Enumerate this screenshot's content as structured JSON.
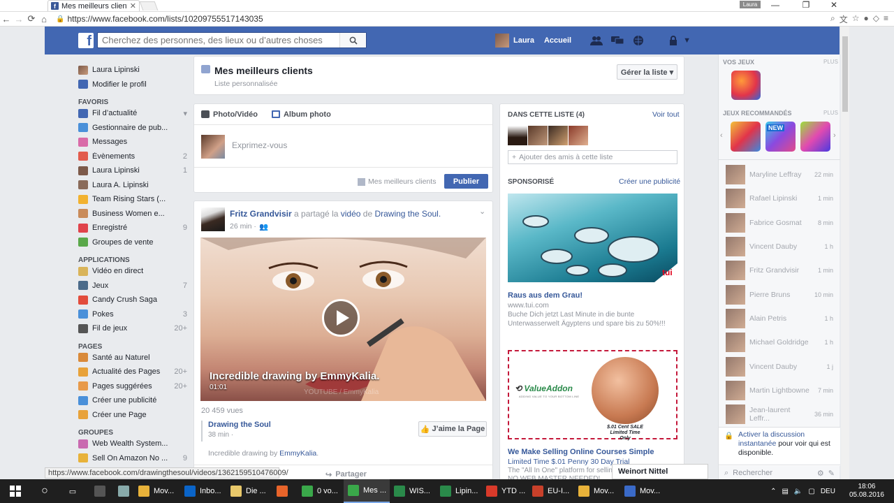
{
  "browser": {
    "tab_title": "Mes meilleurs clients",
    "profile_chip": "Laura",
    "url": "https://www.facebook.com/lists/10209755517143035",
    "status_url": "https://www.facebook.com/drawingthesoul/videos/1362159510476009/"
  },
  "header": {
    "search_placeholder": "Cherchez des personnes, des lieux ou d’autres choses",
    "user_name": "Laura",
    "home": "Accueil"
  },
  "left_nav": {
    "profile": [
      {
        "label": "Laura Lipinski"
      },
      {
        "label": "Modifier le profil"
      }
    ],
    "favoris_title": "FAVORIS",
    "favoris": [
      {
        "label": "Fil d’actualité",
        "count": "▾",
        "color": "#4267b2"
      },
      {
        "label": "Gestionnaire de pub...",
        "count": "",
        "color": "#4a90d9"
      },
      {
        "label": "Messages",
        "count": "",
        "color": "#d96ba8"
      },
      {
        "label": "Évènements",
        "count": "2",
        "color": "#e25b4c"
      },
      {
        "label": "Laura Lipinski",
        "count": "1",
        "color": "#7d5a4a"
      },
      {
        "label": "Laura A. Lipinski",
        "count": "",
        "color": "#8a6b5a"
      },
      {
        "label": "Team Rising Stars (...",
        "count": "",
        "color": "#f2b230"
      },
      {
        "label": "Business Women e...",
        "count": "",
        "color": "#c98b5a"
      },
      {
        "label": "Enregistré",
        "count": "9",
        "color": "#e0434b"
      },
      {
        "label": "Groupes de vente",
        "count": "",
        "color": "#5aa84a"
      }
    ],
    "applications_title": "APPLICATIONS",
    "applications": [
      {
        "label": "Vidéo en direct",
        "count": "",
        "color": "#d9b45a"
      },
      {
        "label": "Jeux",
        "count": "7",
        "color": "#4b6b8a"
      },
      {
        "label": "Candy Crush Saga",
        "count": "",
        "color": "#e24c3c"
      },
      {
        "label": "Pokes",
        "count": "3",
        "color": "#4a90d9"
      },
      {
        "label": "Fil de jeux",
        "count": "20+",
        "color": "#555"
      }
    ],
    "pages_title": "PAGES",
    "pages": [
      {
        "label": "Santé au Naturel",
        "count": "",
        "color": "#d98a3a"
      },
      {
        "label": "Actualité des Pages",
        "count": "20+",
        "color": "#e8a23a"
      },
      {
        "label": "Pages suggérées",
        "count": "20+",
        "color": "#e89a4a"
      },
      {
        "label": "Créer une publicité",
        "count": "",
        "color": "#4a90d9"
      },
      {
        "label": "Créer une Page",
        "count": "",
        "color": "#e8a23a"
      }
    ],
    "groupes_title": "GROUPES",
    "groupes": [
      {
        "label": "Web Wealth System...",
        "count": "",
        "color": "#c96ab0"
      },
      {
        "label": "Sell On Amazon No ...",
        "count": "9",
        "color": "#e8b23a"
      }
    ]
  },
  "list_header": {
    "title": "Mes meilleurs clients",
    "subtitle": "Liste personnalisée",
    "manage_button": "Gérer la liste ▾"
  },
  "composer": {
    "tab_photo": "Photo/Vidéo",
    "tab_album": "Album photo",
    "placeholder": "Exprimez-vous",
    "audience": "Mes meilleurs clients",
    "publish": "Publier"
  },
  "post": {
    "author": "Fritz Grandvisir",
    "shared": " a partagé la ",
    "video_word": "vidéo",
    "of": " de ",
    "page": "Drawing the Soul.",
    "time": "26 min ·",
    "video_title": "Incredible drawing by EmmyKalia.",
    "video_duration": "01:01",
    "video_watermark": "YOUTUBE / EmmyKalia",
    "views": "20 459 vues",
    "source_name": "Drawing the Soul",
    "source_time": "38 min ·",
    "like_page": "J’aime la Page",
    "desc_prefix": "Incredible drawing by ",
    "desc_link": "EmmyKalia",
    "desc_suffix": ".",
    "share": "Partager"
  },
  "list_panel": {
    "members_title": "DANS CETTE LISTE (4)",
    "see_all": "Voir tout",
    "add_placeholder": "Ajouter des amis à cette liste"
  },
  "sponsored": {
    "title": "SPONSORISÉ",
    "create_ad": "Créer une publicité",
    "ad1": {
      "headline": "Raus aus dem Grau!",
      "domain": "www.tui.com",
      "text": "Buche Dich jetzt Last Minute in die bunte Unterwasserwelt Ägyptens und spare bis zu 50%!!!",
      "brand": "tui"
    },
    "ad2": {
      "logo": "ValueAddon",
      "logo_tag": "ADDING VALUE TO YOUR BOTTOM LINE",
      "coin_caption1": "$.01 Cent SALE",
      "coin_caption2": "Limited Time Only",
      "headline": "We Make Selling Online Courses Simple",
      "line1": "Limited Time $.01 Penny 30 Day Trial",
      "line2": "The \"All In One\" platform for selling",
      "line3": "NO WEB MASTER NEEDED!"
    }
  },
  "right_sidebar": {
    "your_games": "VOS JEUX",
    "more": "PLUS",
    "recommended": "JEUX RECOMMANDÉS",
    "more2": "PLUS",
    "game2_badge": "NEW",
    "friends": [
      {
        "name": "Maryline Leffray",
        "time": "22 min"
      },
      {
        "name": "Rafael Lipinski",
        "time": "1 min"
      },
      {
        "name": "Fabrice Gosmat",
        "time": "8 min"
      },
      {
        "name": "Vincent Dauby",
        "time": "1 h"
      },
      {
        "name": "Fritz Grandvisir",
        "time": "1 min"
      },
      {
        "name": "Pierre Bruns",
        "time": "10 min"
      },
      {
        "name": "Alain Petris",
        "time": "1 h"
      },
      {
        "name": "Michael Goldridge",
        "time": "1 h"
      },
      {
        "name": "Vincent Dauby",
        "time": "1 j"
      },
      {
        "name": "Martin Lightbowne",
        "time": "7 min"
      },
      {
        "name": "Jean-laurent Leffr...",
        "time": "36 min"
      }
    ],
    "chat_link": "Activer la discussion instantanée",
    "chat_text": " pour voir qui est disponible.",
    "search": "Rechercher"
  },
  "chat_popup": "Weinort Nittel",
  "taskbar": {
    "items": [
      {
        "label": "Mov...",
        "color": "#e8b23a"
      },
      {
        "label": "Inbo...",
        "color": "#0a64c8"
      },
      {
        "label": "Die ...",
        "color": "#e8c86a"
      },
      {
        "label": "",
        "color": "#e8642a"
      },
      {
        "label": "0 vo...",
        "color": "#3aa84a"
      },
      {
        "label": "Mes ...",
        "color": "#3aa84a",
        "active": true
      },
      {
        "label": "WIS...",
        "color": "#2a8a4a"
      },
      {
        "label": "Lipin...",
        "color": "#2a8a4a"
      },
      {
        "label": "YTD ...",
        "color": "#d93a2a"
      },
      {
        "label": "EU-I...",
        "color": "#c8402a"
      },
      {
        "label": "Mov...",
        "color": "#e8b23a"
      },
      {
        "label": "Mov...",
        "color": "#3a6ac8"
      }
    ],
    "lang": "DEU",
    "time": "18:06",
    "date": "05.08.2016"
  }
}
